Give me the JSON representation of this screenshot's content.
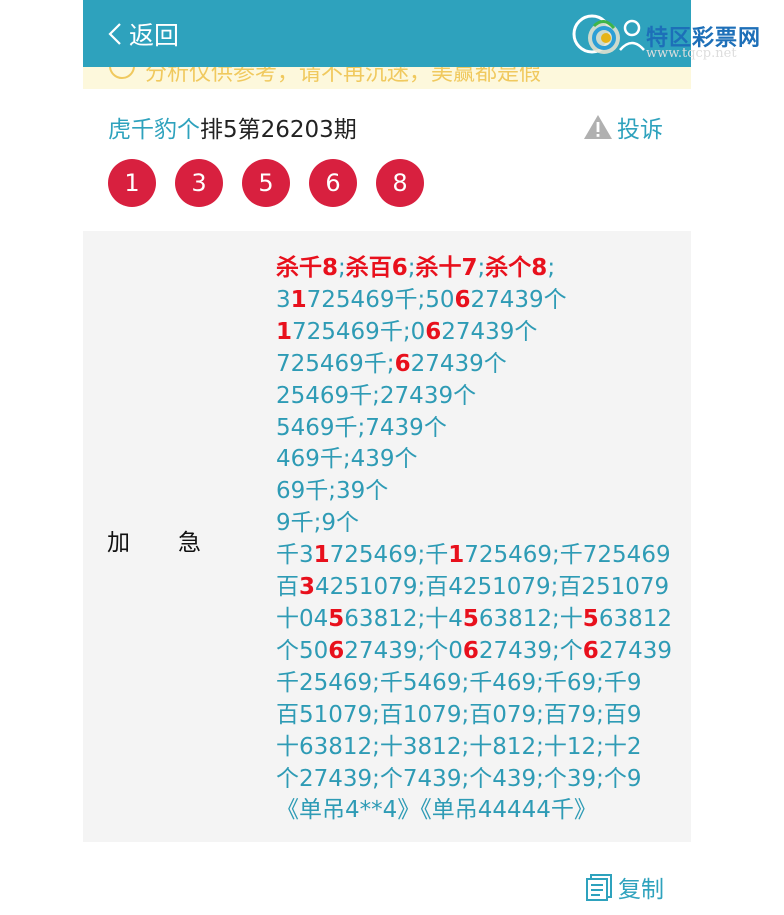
{
  "header": {
    "back_label": "返回"
  },
  "logo": {
    "name": "特区彩票网",
    "url": "www.tqcp.net"
  },
  "notice": {
    "text": "分析仅供参考，请不再沉迷，美赢都是假"
  },
  "post": {
    "author": "虎千豹个",
    "title": "排5第26203期",
    "report_label": "投诉",
    "balls": [
      "1",
      "3",
      "5",
      "6",
      "8"
    ]
  },
  "panel": {
    "label_a": "加",
    "label_b": "急",
    "lines": [
      [
        {
          "t": "杀千8",
          "h": true
        },
        {
          "t": ";"
        },
        {
          "t": "杀百6",
          "h": true
        },
        {
          "t": ";"
        },
        {
          "t": "杀十7",
          "h": true
        },
        {
          "t": ";"
        },
        {
          "t": "杀个8",
          "h": true
        },
        {
          "t": ";"
        }
      ],
      [
        {
          "t": "3"
        },
        {
          "t": "1",
          "h": true
        },
        {
          "t": "725469千;50"
        },
        {
          "t": "6",
          "h": true
        },
        {
          "t": "27439个"
        }
      ],
      [
        {
          "t": "1",
          "h": true
        },
        {
          "t": "725469千;0"
        },
        {
          "t": "6",
          "h": true
        },
        {
          "t": "27439个"
        }
      ],
      [
        {
          "t": "725469千;"
        },
        {
          "t": "6",
          "h": true
        },
        {
          "t": "27439个"
        }
      ],
      [
        {
          "t": "25469千;27439个"
        }
      ],
      [
        {
          "t": "5469千;7439个"
        }
      ],
      [
        {
          "t": "469千;439个"
        }
      ],
      [
        {
          "t": "69千;39个"
        }
      ],
      [
        {
          "t": "9千;9个"
        }
      ],
      [
        {
          "t": "千3"
        },
        {
          "t": "1",
          "h": true
        },
        {
          "t": "725469;千"
        },
        {
          "t": "1",
          "h": true
        },
        {
          "t": "725469;千725469"
        }
      ],
      [
        {
          "t": "百"
        },
        {
          "t": "3",
          "h": true
        },
        {
          "t": "4251079;百4251079;百251079"
        }
      ],
      [
        {
          "t": "十04"
        },
        {
          "t": "5",
          "h": true
        },
        {
          "t": "63812;十4"
        },
        {
          "t": "5",
          "h": true
        },
        {
          "t": "63812;十"
        },
        {
          "t": "5",
          "h": true
        },
        {
          "t": "63812"
        }
      ],
      [
        {
          "t": "个50"
        },
        {
          "t": "6",
          "h": true
        },
        {
          "t": "27439;个0"
        },
        {
          "t": "6",
          "h": true
        },
        {
          "t": "27439;个"
        },
        {
          "t": "6",
          "h": true
        },
        {
          "t": "27439"
        }
      ],
      [
        {
          "t": "千25469;千5469;千469;千69;千9"
        }
      ],
      [
        {
          "t": "百51079;百1079;百079;百79;百9"
        }
      ],
      [
        {
          "t": "十63812;十3812;十812;十12;十2"
        }
      ],
      [
        {
          "t": "个27439;个7439;个439;个39;个9"
        }
      ],
      [
        {
          "t": "《单吊4**4》《单吊44444千》"
        }
      ]
    ]
  },
  "footer": {
    "copy_label": "复制"
  },
  "colors": {
    "accent": "#2ea2bd",
    "ball": "#d8203f",
    "highlight": "#e8101c"
  }
}
